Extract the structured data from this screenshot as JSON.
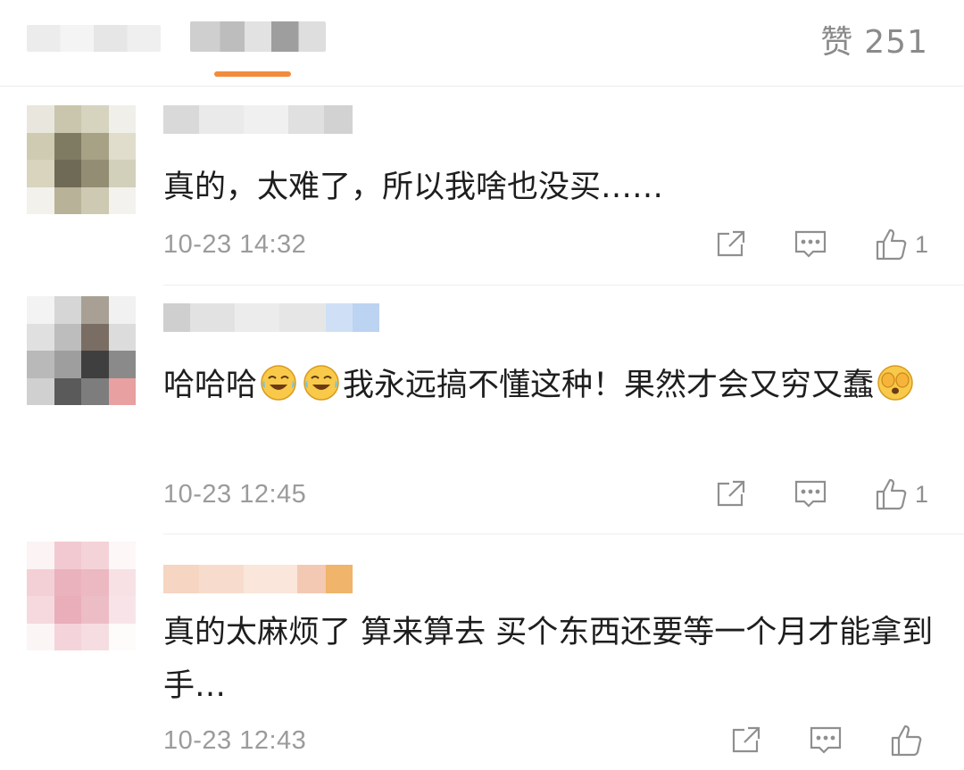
{
  "header": {
    "like_label": "赞",
    "like_count": "251"
  },
  "comments": [
    {
      "text": "真的，太难了，所以我啥也没买……",
      "time": "10-23 14:32",
      "like_count": "1"
    },
    {
      "text_part1": "哈哈哈",
      "text_part2": "我永远搞不懂这种！果然才会又穷又蠢",
      "time": "10-23 12:45",
      "like_count": "1"
    },
    {
      "text": "真的太麻烦了 算来算去 买个东西还要等一个月才能拿到手…",
      "time": "10-23 12:43",
      "like_count": ""
    }
  ],
  "icons": {
    "share": "share-icon",
    "reply": "comment-icon",
    "like": "thumbs-up-icon",
    "laugh_cry": "laugh-cry-emoji",
    "cover_face": "cover-face-emoji"
  },
  "colors": {
    "accent": "#f28b3c",
    "muted_text": "#9b9b9b",
    "icon": "#8f8f8f"
  }
}
